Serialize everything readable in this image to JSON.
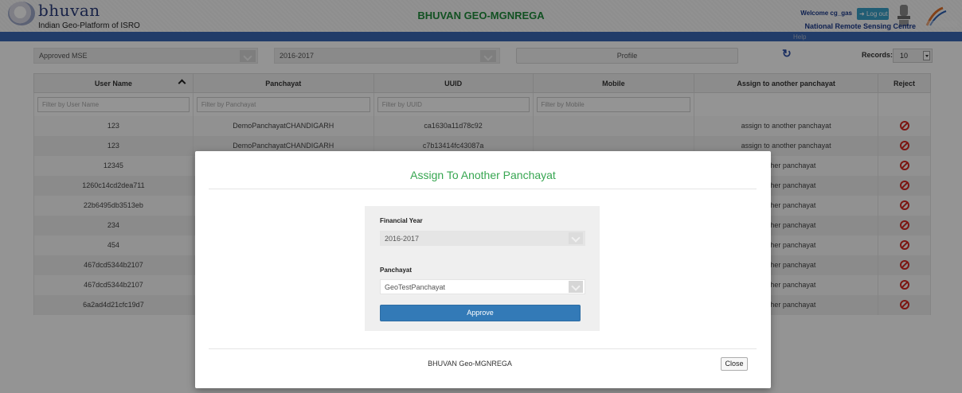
{
  "header": {
    "logo_text": "bhuvan",
    "logo_subtitle": "Indian Geo-Platform of ISRO",
    "app_title": "BHUVAN GEO-MGNREGA",
    "welcome_text": "Welcome cg_gas",
    "logout_label": "Log out",
    "org_name": "National Remote Sensing Centre",
    "help_label": "Help",
    "brand_color": "#3a68b6"
  },
  "filters": {
    "status": "Approved MSE",
    "year": "2016-2017",
    "profile_label": "Profile",
    "records_label": "Records:",
    "records_value": "10"
  },
  "table": {
    "columns": [
      "User Name",
      "Panchayat",
      "UUID",
      "Mobile",
      "Assign to another panchayat",
      "Reject"
    ],
    "filter_placeholders": [
      "Filter by User Name",
      "Filter by Panchayat",
      "Filter by UUID",
      "Filter by Mobile"
    ],
    "rows": [
      {
        "user": "123",
        "panchayat": "DemoPanchayatCHANDIGARH",
        "uuid": "ca1630a11d78c92",
        "mobile": "",
        "assign": "assign to another panchayat"
      },
      {
        "user": "123",
        "panchayat": "DemoPanchayatCHANDIGARH",
        "uuid": "c7b13414fc43087a",
        "mobile": "",
        "assign": "assign to another panchayat"
      },
      {
        "user": "12345",
        "panchayat": "",
        "uuid": "",
        "mobile": "",
        "assign": "another panchayat"
      },
      {
        "user": "1260c14cd2dea711",
        "panchayat": "",
        "uuid": "",
        "mobile": "",
        "assign": "another panchayat"
      },
      {
        "user": "22b6495db3513eb",
        "panchayat": "",
        "uuid": "",
        "mobile": "",
        "assign": "another panchayat"
      },
      {
        "user": "234",
        "panchayat": "",
        "uuid": "",
        "mobile": "",
        "assign": "another panchayat"
      },
      {
        "user": "454",
        "panchayat": "",
        "uuid": "",
        "mobile": "",
        "assign": "another panchayat"
      },
      {
        "user": "467dcd5344b2107",
        "panchayat": "",
        "uuid": "",
        "mobile": "",
        "assign": "another panchayat"
      },
      {
        "user": "467dcd5344b2107",
        "panchayat": "",
        "uuid": "",
        "mobile": "",
        "assign": "another panchayat"
      },
      {
        "user": "6a2ad4d21cfc19d7",
        "panchayat": "",
        "uuid": "",
        "mobile": "",
        "assign": "another panchayat"
      }
    ]
  },
  "modal": {
    "title": "Assign To Another Panchayat",
    "financial_year_label": "Financial Year",
    "financial_year_value": "2016-2017",
    "panchayat_label": "Panchayat",
    "panchayat_value": "GeoTestPanchayat",
    "approve_label": "Approve",
    "footer_text": "BHUVAN Geo-MGNREGA",
    "close_label": "Close",
    "title_color": "#37a651",
    "button_color": "#337ab7"
  }
}
